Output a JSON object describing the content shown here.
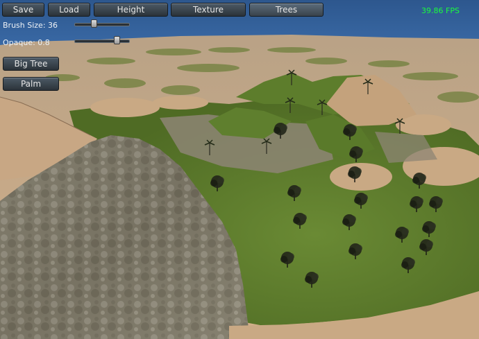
{
  "toolbar": {
    "save_label": "Save",
    "load_label": "Load",
    "height_label": "Height",
    "texture_label": "Texture",
    "trees_label": "Trees"
  },
  "fps_text": "39.86 FPS",
  "brush": {
    "size_label": "Brush Size: 36",
    "size_value": 36,
    "opacity_label": "Opaque: 0.8",
    "opacity_value": 0.8
  },
  "tree_tools": {
    "big_tree_label": "Big Tree",
    "palm_label": "Palm"
  },
  "colors": {
    "sky": "#2f5a93",
    "sand": "#c9a984",
    "grass": "#5b7a2d",
    "rock": "#8a8576",
    "fps": "#19ff3c"
  }
}
